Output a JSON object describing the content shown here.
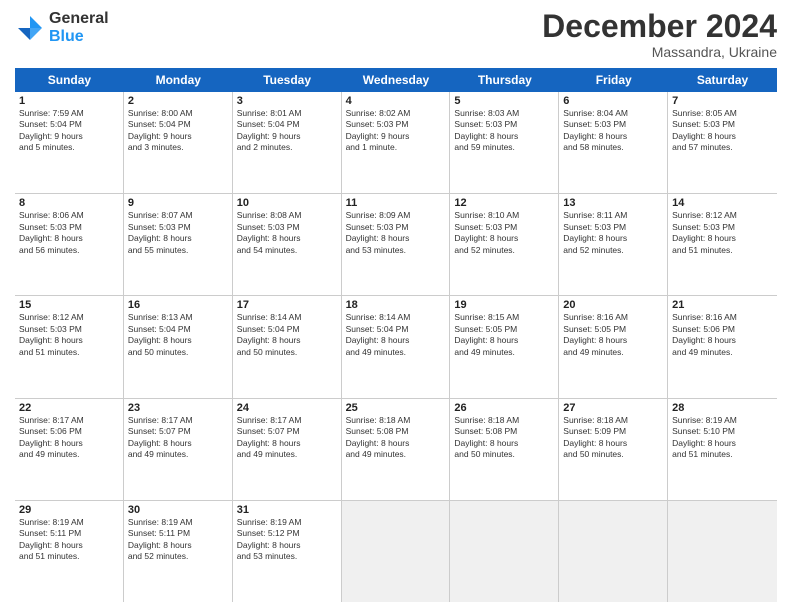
{
  "header": {
    "logo_general": "General",
    "logo_blue": "Blue",
    "month": "December 2024",
    "location": "Massandra, Ukraine"
  },
  "weekdays": [
    "Sunday",
    "Monday",
    "Tuesday",
    "Wednesday",
    "Thursday",
    "Friday",
    "Saturday"
  ],
  "rows": [
    [
      {
        "day": "1",
        "info": "Sunrise: 7:59 AM\nSunset: 5:04 PM\nDaylight: 9 hours\nand 5 minutes."
      },
      {
        "day": "2",
        "info": "Sunrise: 8:00 AM\nSunset: 5:04 PM\nDaylight: 9 hours\nand 3 minutes."
      },
      {
        "day": "3",
        "info": "Sunrise: 8:01 AM\nSunset: 5:04 PM\nDaylight: 9 hours\nand 2 minutes."
      },
      {
        "day": "4",
        "info": "Sunrise: 8:02 AM\nSunset: 5:03 PM\nDaylight: 9 hours\nand 1 minute."
      },
      {
        "day": "5",
        "info": "Sunrise: 8:03 AM\nSunset: 5:03 PM\nDaylight: 8 hours\nand 59 minutes."
      },
      {
        "day": "6",
        "info": "Sunrise: 8:04 AM\nSunset: 5:03 PM\nDaylight: 8 hours\nand 58 minutes."
      },
      {
        "day": "7",
        "info": "Sunrise: 8:05 AM\nSunset: 5:03 PM\nDaylight: 8 hours\nand 57 minutes."
      }
    ],
    [
      {
        "day": "8",
        "info": "Sunrise: 8:06 AM\nSunset: 5:03 PM\nDaylight: 8 hours\nand 56 minutes."
      },
      {
        "day": "9",
        "info": "Sunrise: 8:07 AM\nSunset: 5:03 PM\nDaylight: 8 hours\nand 55 minutes."
      },
      {
        "day": "10",
        "info": "Sunrise: 8:08 AM\nSunset: 5:03 PM\nDaylight: 8 hours\nand 54 minutes."
      },
      {
        "day": "11",
        "info": "Sunrise: 8:09 AM\nSunset: 5:03 PM\nDaylight: 8 hours\nand 53 minutes."
      },
      {
        "day": "12",
        "info": "Sunrise: 8:10 AM\nSunset: 5:03 PM\nDaylight: 8 hours\nand 52 minutes."
      },
      {
        "day": "13",
        "info": "Sunrise: 8:11 AM\nSunset: 5:03 PM\nDaylight: 8 hours\nand 52 minutes."
      },
      {
        "day": "14",
        "info": "Sunrise: 8:12 AM\nSunset: 5:03 PM\nDaylight: 8 hours\nand 51 minutes."
      }
    ],
    [
      {
        "day": "15",
        "info": "Sunrise: 8:12 AM\nSunset: 5:03 PM\nDaylight: 8 hours\nand 51 minutes."
      },
      {
        "day": "16",
        "info": "Sunrise: 8:13 AM\nSunset: 5:04 PM\nDaylight: 8 hours\nand 50 minutes."
      },
      {
        "day": "17",
        "info": "Sunrise: 8:14 AM\nSunset: 5:04 PM\nDaylight: 8 hours\nand 50 minutes."
      },
      {
        "day": "18",
        "info": "Sunrise: 8:14 AM\nSunset: 5:04 PM\nDaylight: 8 hours\nand 49 minutes."
      },
      {
        "day": "19",
        "info": "Sunrise: 8:15 AM\nSunset: 5:05 PM\nDaylight: 8 hours\nand 49 minutes."
      },
      {
        "day": "20",
        "info": "Sunrise: 8:16 AM\nSunset: 5:05 PM\nDaylight: 8 hours\nand 49 minutes."
      },
      {
        "day": "21",
        "info": "Sunrise: 8:16 AM\nSunset: 5:06 PM\nDaylight: 8 hours\nand 49 minutes."
      }
    ],
    [
      {
        "day": "22",
        "info": "Sunrise: 8:17 AM\nSunset: 5:06 PM\nDaylight: 8 hours\nand 49 minutes."
      },
      {
        "day": "23",
        "info": "Sunrise: 8:17 AM\nSunset: 5:07 PM\nDaylight: 8 hours\nand 49 minutes."
      },
      {
        "day": "24",
        "info": "Sunrise: 8:17 AM\nSunset: 5:07 PM\nDaylight: 8 hours\nand 49 minutes."
      },
      {
        "day": "25",
        "info": "Sunrise: 8:18 AM\nSunset: 5:08 PM\nDaylight: 8 hours\nand 49 minutes."
      },
      {
        "day": "26",
        "info": "Sunrise: 8:18 AM\nSunset: 5:08 PM\nDaylight: 8 hours\nand 50 minutes."
      },
      {
        "day": "27",
        "info": "Sunrise: 8:18 AM\nSunset: 5:09 PM\nDaylight: 8 hours\nand 50 minutes."
      },
      {
        "day": "28",
        "info": "Sunrise: 8:19 AM\nSunset: 5:10 PM\nDaylight: 8 hours\nand 51 minutes."
      }
    ],
    [
      {
        "day": "29",
        "info": "Sunrise: 8:19 AM\nSunset: 5:11 PM\nDaylight: 8 hours\nand 51 minutes."
      },
      {
        "day": "30",
        "info": "Sunrise: 8:19 AM\nSunset: 5:11 PM\nDaylight: 8 hours\nand 52 minutes."
      },
      {
        "day": "31",
        "info": "Sunrise: 8:19 AM\nSunset: 5:12 PM\nDaylight: 8 hours\nand 53 minutes."
      },
      {
        "day": "",
        "info": ""
      },
      {
        "day": "",
        "info": ""
      },
      {
        "day": "",
        "info": ""
      },
      {
        "day": "",
        "info": ""
      }
    ]
  ]
}
